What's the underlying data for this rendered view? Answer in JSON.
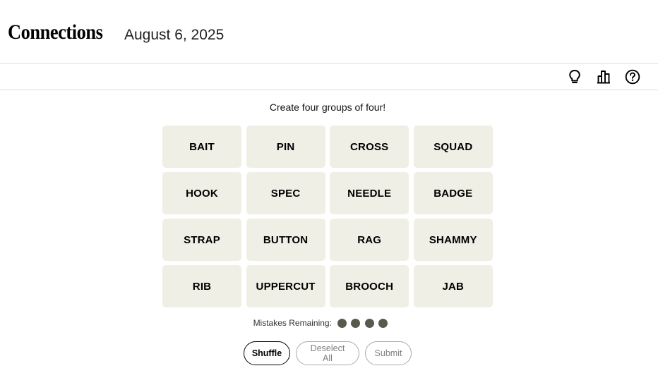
{
  "header": {
    "title": "Connections",
    "date": "August 6, 2025"
  },
  "toolbar": {
    "icons": [
      "hint-lightbulb-icon",
      "stats-bar-chart-icon",
      "help-question-icon"
    ]
  },
  "instructions": "Create four groups of four!",
  "board": {
    "tiles": [
      "BAIT",
      "PIN",
      "CROSS",
      "SQUAD",
      "HOOK",
      "SPEC",
      "NEEDLE",
      "BADGE",
      "STRAP",
      "BUTTON",
      "RAG",
      "SHAMMY",
      "RIB",
      "UPPERCUT",
      "BROOCH",
      "JAB"
    ]
  },
  "mistakes": {
    "label": "Mistakes Remaining:",
    "remaining": 4
  },
  "actions": {
    "shuffle": "Shuffle",
    "deselect_all": "Deselect All",
    "submit": "Submit"
  },
  "colors": {
    "tile_background": "#efefe6",
    "mistake_dot": "#5a594e"
  }
}
